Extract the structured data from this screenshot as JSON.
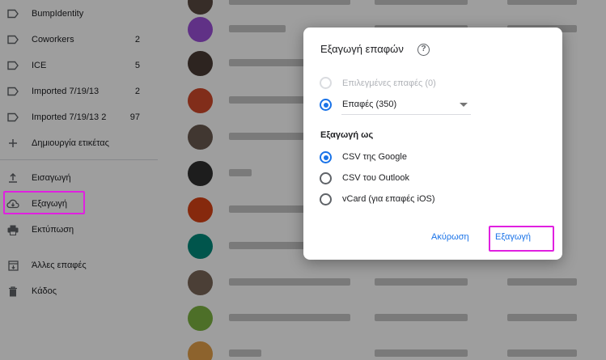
{
  "sidebar": {
    "labels": [
      {
        "label": "BumpIdentity",
        "count": ""
      },
      {
        "label": "Coworkers",
        "count": "2"
      },
      {
        "label": "ICE",
        "count": "5"
      },
      {
        "label": "Imported 7/19/13",
        "count": "2"
      },
      {
        "label": "Imported 7/19/13 2",
        "count": "97"
      }
    ],
    "create_label": "Δημιουργία ετικέτας",
    "import": "Εισαγωγή",
    "export": "Εξαγωγή",
    "print": "Εκτύπωση",
    "other_contacts": "Άλλες επαφές",
    "trash": "Κάδος"
  },
  "dialog": {
    "title": "Εξαγωγή επαφών",
    "selected_contacts": "Επιλεγμένες επαφές (0)",
    "contacts_option": "Επαφές (350)",
    "export_as": "Εξαγωγή ως",
    "formats": [
      "CSV της Google",
      "CSV του Outlook",
      "vCard (για επαφές iOS)"
    ],
    "cancel": "Ακύρωση",
    "export": "Εξαγωγή"
  },
  "colors": {
    "accent": "#1a73e8",
    "highlight": "#e020e0"
  },
  "icons": {
    "label": "label-outline-icon",
    "add": "plus-icon",
    "import": "upload-icon",
    "export": "cloud-download-icon",
    "print": "printer-icon",
    "other_contacts": "archive-icon",
    "trash": "trash-icon",
    "help": "help-circle-icon"
  }
}
